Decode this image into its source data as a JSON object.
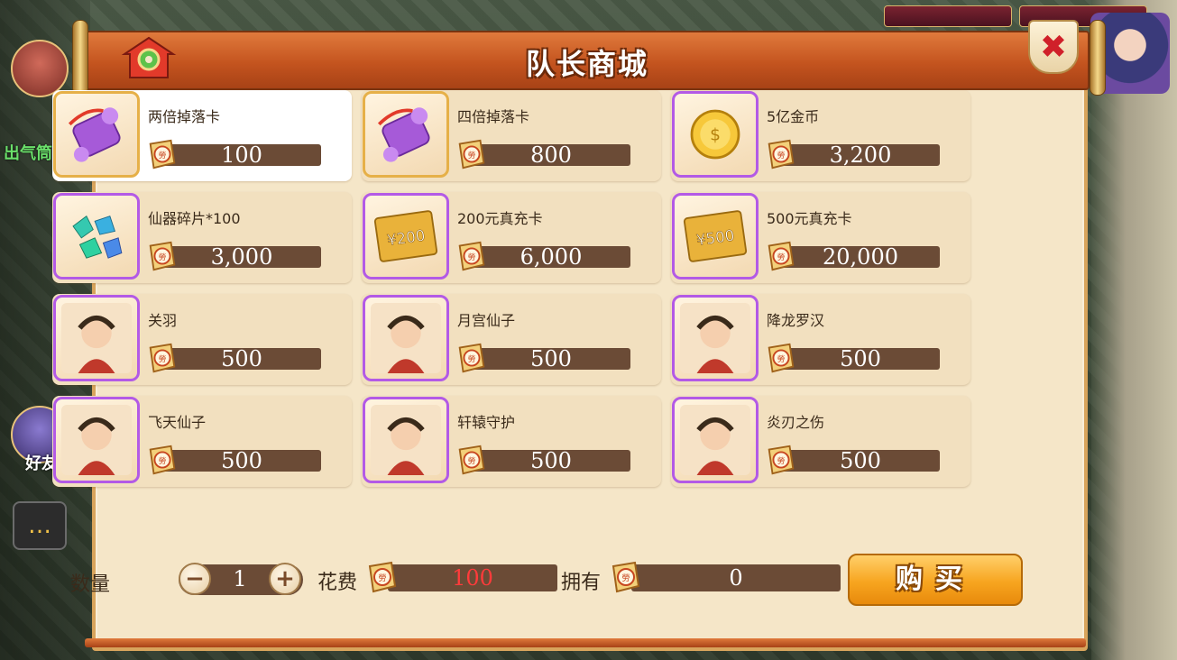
{
  "dialog": {
    "title": "队长商城",
    "close_icon": "close-icon"
  },
  "hud": {
    "left_texts": [
      "出气筒"
    ],
    "friend_label": "好友"
  },
  "items": [
    {
      "name": "两倍掉落卡",
      "price": "100",
      "frame": "gold",
      "art": "drop-card-icon"
    },
    {
      "name": "四倍掉落卡",
      "price": "800",
      "frame": "gold",
      "art": "drop-card-icon"
    },
    {
      "name": "5亿金币",
      "price": "3,200",
      "frame": "purple",
      "art": "gold-coin-icon"
    },
    {
      "name": "仙器碎片*100",
      "price": "3,000",
      "frame": "purple",
      "art": "gem-shards-icon"
    },
    {
      "name": "200元真充卡",
      "price": "6,000",
      "frame": "purple",
      "art": "recharge-card-icon",
      "art_label": "¥200"
    },
    {
      "name": "500元真充卡",
      "price": "20,000",
      "frame": "purple",
      "art": "recharge-card-icon",
      "art_label": "¥500"
    },
    {
      "name": "关羽",
      "price": "500",
      "frame": "purple",
      "art": "hero-portrait"
    },
    {
      "name": "月宫仙子",
      "price": "500",
      "frame": "purple",
      "art": "hero-portrait"
    },
    {
      "name": "降龙罗汉",
      "price": "500",
      "frame": "purple",
      "art": "hero-portrait"
    },
    {
      "name": "飞天仙子",
      "price": "500",
      "frame": "purple",
      "art": "hero-portrait"
    },
    {
      "name": "轩辕守护",
      "price": "500",
      "frame": "purple",
      "art": "hero-portrait"
    },
    {
      "name": "炎刃之伤",
      "price": "500",
      "frame": "purple",
      "art": "hero-portrait"
    }
  ],
  "controls": {
    "qty_label": "数量",
    "qty_value": "1",
    "minus": "−",
    "plus": "+",
    "cost_label": "花费",
    "cost_value": "100",
    "own_label": "拥有",
    "own_value": "0",
    "buy_label": "购买",
    "currency_icon": "honor-scroll-icon"
  },
  "colors": {
    "accent": "#c4541f",
    "frame_purple": "#b35ae6",
    "frame_gold": "#e6b048",
    "price_bar": "#6b4b36",
    "cost_text": "#ff3b3b"
  }
}
